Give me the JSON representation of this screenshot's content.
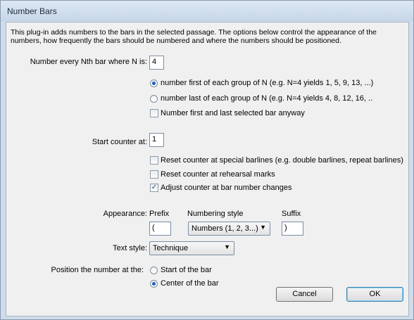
{
  "window": {
    "title": "Number Bars"
  },
  "intro_text": "This plug-in adds numbers to the bars in the selected passage. The options below control the appearance of the numbers, how frequently the bars should be numbered and where the numbers should be positioned.",
  "every_n": {
    "label": "Number every Nth bar where N is:",
    "value": "4"
  },
  "group_options": [
    {
      "label": "number first of each group of N (e.g. N=4 yields 1, 5, 9, 13, ...)",
      "selected": true
    },
    {
      "label": "number last of each group of N (e.g. N=4 yields 4, 8, 12, 16, ..",
      "selected": false
    }
  ],
  "first_last_check": {
    "label": "Number first and last selected bar anyway",
    "checked": false
  },
  "start_counter": {
    "label": "Start counter at:",
    "value": "1"
  },
  "counter_options": [
    {
      "label": "Reset counter at special barlines (e.g. double barlines, repeat barlines)",
      "checked": false
    },
    {
      "label": "Reset counter at rehearsal marks",
      "checked": false
    },
    {
      "label": "Adjust counter at bar number changes",
      "checked": true
    }
  ],
  "appearance": {
    "label": "Appearance:",
    "prefix_label": "Prefix",
    "prefix_value": "(",
    "style_label": "Numbering style",
    "style_value": "Numbers (1, 2, 3...)",
    "suffix_label": "Suffix",
    "suffix_value": ")"
  },
  "text_style": {
    "label": "Text style:",
    "value": "Technique"
  },
  "position": {
    "label": "Position the number at the:",
    "options": [
      {
        "label": "Start of the bar",
        "selected": false
      },
      {
        "label": "Center of the bar",
        "selected": true
      }
    ]
  },
  "buttons": {
    "cancel": "Cancel",
    "ok": "OK"
  },
  "icons": {
    "check": "check-mark-icon",
    "dropdown": "chevron-down-icon"
  },
  "colors": {
    "radio_dot": "#1b5fbf",
    "title_bar": "#cfdceb",
    "default_button_border": "#3c7fb1"
  }
}
